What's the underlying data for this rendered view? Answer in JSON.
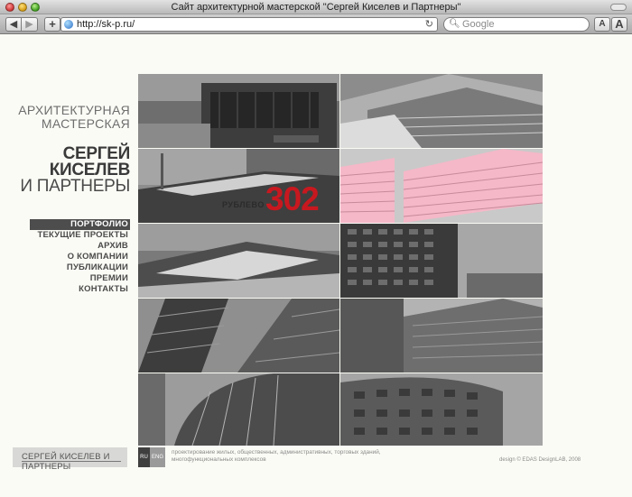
{
  "browser": {
    "window_title": "Сайт архитектурной мастерской \"Сергей Киселев и Партнеры\"",
    "url": "http://sk-p.ru/",
    "search_placeholder": "Google",
    "back_icon": "◀",
    "forward_icon": "▶",
    "add_icon": "+",
    "reload_icon": "↻",
    "search_icon": "magnifier-icon",
    "font_small_label": "A",
    "font_large_label": "A",
    "new_tab_icon": "+"
  },
  "brand": {
    "line1": "АРХИТЕКТУРНАЯ",
    "line2": "МАСТЕРСКАЯ",
    "line3": "СЕРГЕЙ",
    "line4": "КИСЕЛЕВ",
    "line5": "И ПАРТНЕРЫ"
  },
  "menu": {
    "items": [
      {
        "label": "ПОРТФОЛИО",
        "active": true
      },
      {
        "label": "ТЕКУЩИЕ ПРОЕКТЫ",
        "active": false
      },
      {
        "label": "АРХИВ",
        "active": false
      },
      {
        "label": "О КОМПАНИИ",
        "active": false
      },
      {
        "label": "ПУБЛИКАЦИИ",
        "active": false
      },
      {
        "label": "ПРЕМИИ",
        "active": false
      },
      {
        "label": "КОНТАКТЫ",
        "active": false
      }
    ]
  },
  "featured": {
    "label": "РУБЛЕВО",
    "number": "302",
    "accent_color": "#c8181f",
    "highlight_tint": "#f4b8c8"
  },
  "footer": {
    "logo_text": "СЕРГЕЙ КИСЕЛЕВ И ПАРТНЕРЫ",
    "lang_ru": "RU",
    "lang_eng": "ENG",
    "description": "проектирование жилых, общественных, административных, торговых зданий, многофункциональных комплексов",
    "credit": "design © EDAS DesignLAB, 2008"
  }
}
